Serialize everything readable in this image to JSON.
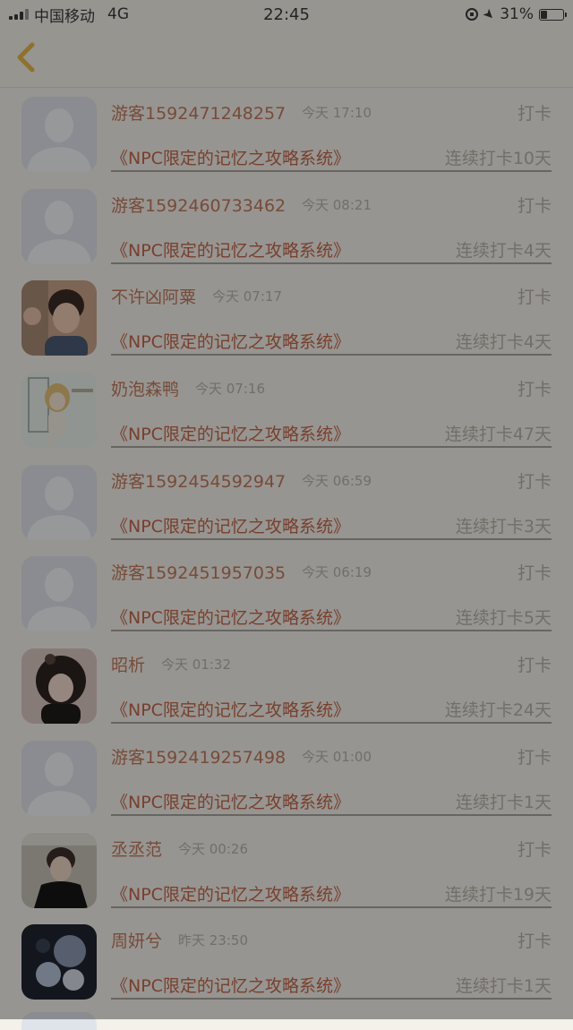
{
  "status_bar": {
    "carrier": "中国移动",
    "network": "4G",
    "time": "22:45",
    "battery": "31%",
    "battery_level": 0.31
  },
  "nav": {
    "back_icon": "chevron-left-icon",
    "accent": "#e6b64a"
  },
  "colors": {
    "name": "#c0795c",
    "title": "#c2664a",
    "muted": "#b8b2a8",
    "overlay": "rgba(0,0,0,0.38)"
  },
  "items": [
    {
      "name": "游客1592471248257",
      "time": "今天 17:10",
      "action": "打卡",
      "title": "《NPC限定的记忆之攻略系统》",
      "streak": "连续打卡10天",
      "avatar": "default"
    },
    {
      "name": "游客1592460733462",
      "time": "今天 08:21",
      "action": "打卡",
      "title": "《NPC限定的记忆之攻略系统》",
      "streak": "连续打卡4天",
      "avatar": "default"
    },
    {
      "name": "不许凶阿粟",
      "time": "今天 07:17",
      "action": "打卡",
      "title": "《NPC限定的记忆之攻略系统》",
      "streak": "连续打卡4天",
      "avatar": "photo-boy"
    },
    {
      "name": "奶泡森鸭",
      "time": "今天 07:16",
      "action": "打卡",
      "title": "《NPC限定的记忆之攻略系统》",
      "streak": "连续打卡47天",
      "avatar": "illustration-girl"
    },
    {
      "name": "游客1592454592947",
      "time": "今天 06:59",
      "action": "打卡",
      "title": "《NPC限定的记忆之攻略系统》",
      "streak": "连续打卡3天",
      "avatar": "default"
    },
    {
      "name": "游客1592451957035",
      "time": "今天 06:19",
      "action": "打卡",
      "title": "《NPC限定的记忆之攻略系统》",
      "streak": "连续打卡5天",
      "avatar": "default"
    },
    {
      "name": "昭析",
      "time": "今天 01:32",
      "action": "打卡",
      "title": "《NPC限定的记忆之攻略系统》",
      "streak": "连续打卡24天",
      "avatar": "photo-girl"
    },
    {
      "name": "游客1592419257498",
      "time": "今天 01:00",
      "action": "打卡",
      "title": "《NPC限定的记忆之攻略系统》",
      "streak": "连续打卡1天",
      "avatar": "default"
    },
    {
      "name": "丞丞范",
      "time": "今天 00:26",
      "action": "打卡",
      "title": "《NPC限定的记忆之攻略系统》",
      "streak": "连续打卡19天",
      "avatar": "photo-man"
    },
    {
      "name": "周妍兮",
      "time": "昨天 23:50",
      "action": "打卡",
      "title": "《NPC限定的记忆之攻略系统》",
      "streak": "连续打卡1天",
      "avatar": "photo-flowers"
    }
  ]
}
